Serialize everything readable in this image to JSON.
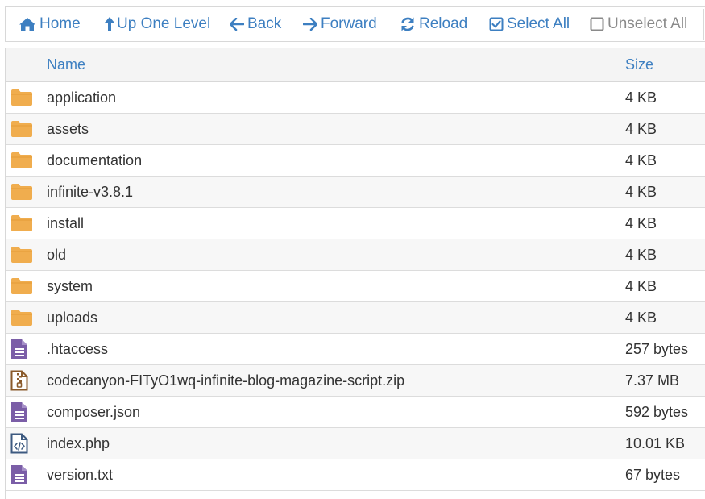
{
  "toolbar": {
    "home": {
      "label": "Home",
      "icon": "home-icon"
    },
    "up": {
      "label": "Up One Level",
      "icon": "arrow-up-icon"
    },
    "back": {
      "label": "Back",
      "icon": "arrow-left-icon"
    },
    "forward": {
      "label": "Forward",
      "icon": "arrow-right-icon"
    },
    "reload": {
      "label": "Reload",
      "icon": "reload-icon"
    },
    "select_all": {
      "label": "Select All",
      "icon": "checkbox-checked-icon"
    },
    "unselect_all": {
      "label": "Unselect All",
      "icon": "checkbox-empty-icon"
    }
  },
  "columns": {
    "name": "Name",
    "size": "Size"
  },
  "files": [
    {
      "name": "application",
      "size": "4 KB",
      "type": "folder"
    },
    {
      "name": "assets",
      "size": "4 KB",
      "type": "folder"
    },
    {
      "name": "documentation",
      "size": "4 KB",
      "type": "folder"
    },
    {
      "name": "infinite-v3.8.1",
      "size": "4 KB",
      "type": "folder"
    },
    {
      "name": "install",
      "size": "4 KB",
      "type": "folder"
    },
    {
      "name": "old",
      "size": "4 KB",
      "type": "folder"
    },
    {
      "name": "system",
      "size": "4 KB",
      "type": "folder"
    },
    {
      "name": "uploads",
      "size": "4 KB",
      "type": "folder"
    },
    {
      "name": ".htaccess",
      "size": "257 bytes",
      "type": "text"
    },
    {
      "name": "codecanyon-FITyO1wq-infinite-blog-magazine-script.zip",
      "size": "7.37 MB",
      "type": "zip"
    },
    {
      "name": "composer.json",
      "size": "592 bytes",
      "type": "text"
    },
    {
      "name": "index.php",
      "size": "10.01 KB",
      "type": "code"
    },
    {
      "name": "version.txt",
      "size": "67 bytes",
      "type": "text"
    }
  ],
  "colors": {
    "accent": "#3d7fc1",
    "folder": "#f0ad4e",
    "text_file": "#7b5ea7",
    "zip_file": "#8a5a2b",
    "code_file": "#3d5a80"
  }
}
